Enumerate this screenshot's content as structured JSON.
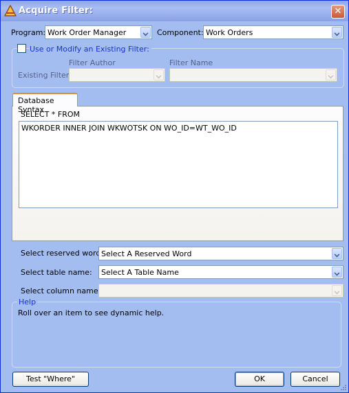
{
  "window": {
    "title": "Acquire Filter:"
  },
  "program": {
    "label": "Program:",
    "value": "Work Order Manager"
  },
  "component": {
    "label": "Component:",
    "value": "Work Orders"
  },
  "existing_filter": {
    "checkbox_label": "Use or Modify an Existing Filter:",
    "checked": false,
    "author_header": "Filter Author",
    "name_header": "Filter Name",
    "row_label": "Existing Filter:",
    "author_value": "",
    "name_value": ""
  },
  "tabs": [
    {
      "label": "Database Syntax",
      "active": true
    }
  ],
  "syntax": {
    "prefix": "SELECT * FROM",
    "query": "WKORDER INNER JOIN WKWOTSK ON WO_ID=WT_WO_ID"
  },
  "selectors": {
    "reserved_word": {
      "label": "Select reserved word:",
      "value": "Select A Reserved Word"
    },
    "table_name": {
      "label": "Select table name:",
      "value": "Select A Table Name"
    },
    "column_name": {
      "label": "Select column name:",
      "value": ""
    }
  },
  "help": {
    "title": "Help",
    "text": "Roll over an item to see dynamic help."
  },
  "buttons": {
    "test_where": "Test \"Where\"",
    "ok": "OK",
    "cancel": "Cancel"
  },
  "icons": {
    "app": "warning-triangle-icon",
    "close": "close-icon",
    "dropdown": "chevron-down-icon"
  },
  "colors": {
    "window_bg": "#a4bdf0",
    "titlebar": "#8fa7e8",
    "close": "#c85a3b",
    "tab_accent": "#e68b2c",
    "link_label": "#1a33c8"
  }
}
